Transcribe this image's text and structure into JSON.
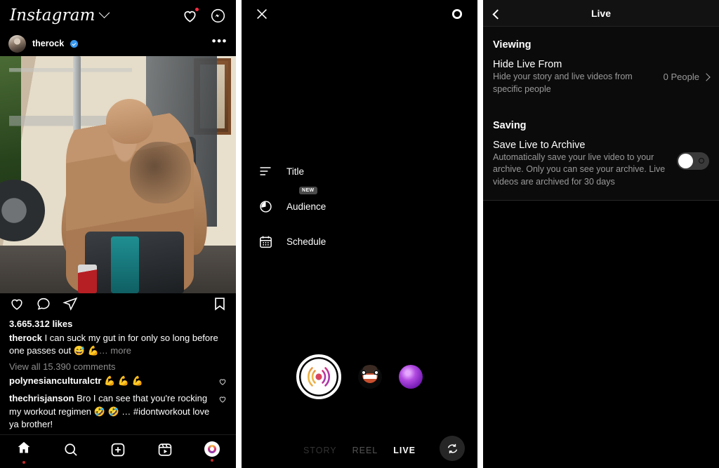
{
  "feed": {
    "app_title": "Instagram",
    "header_icons": [
      "heart-icon",
      "messenger-icon"
    ],
    "post": {
      "username": "therock",
      "verified": true,
      "more_options": "•••",
      "likes": "3.665.312 likes",
      "caption_user": "therock",
      "caption_text": " I can suck my gut in for only so long before one passes out 😅 💪",
      "caption_more": "… more",
      "view_comments": "View all 15.390 comments",
      "comments": [
        {
          "user": "polynesianculturalctr",
          "text": " 💪 💪 💪"
        },
        {
          "user": "thechrisjanson",
          "text": " Bro I can see that you're rocking my workout regimen 🤣 🤣 … #idontworkout love ya brother!"
        }
      ]
    },
    "tabs": [
      {
        "name": "home",
        "icon": "home-icon",
        "badge": true
      },
      {
        "name": "search",
        "icon": "search-icon",
        "badge": false
      },
      {
        "name": "create",
        "icon": "plus-box-icon",
        "badge": false
      },
      {
        "name": "reels",
        "icon": "reels-icon",
        "badge": false
      },
      {
        "name": "profile",
        "icon": "profile-avatar-icon",
        "badge": true
      }
    ]
  },
  "live_composer": {
    "close_label": "✕",
    "settings_icon": "gear-icon",
    "options": [
      {
        "icon": "title-lines-icon",
        "label": "Title",
        "badge": null
      },
      {
        "icon": "audience-icon",
        "label": "Audience",
        "badge": "NEW"
      },
      {
        "icon": "calendar-icon",
        "label": "Schedule",
        "badge": null
      }
    ],
    "shutter": "live-broadcast-button",
    "filters": [
      {
        "name": "face-filter"
      },
      {
        "name": "orb-filter"
      }
    ],
    "modes": [
      {
        "label": "STORY",
        "state": "faded"
      },
      {
        "label": "REEL",
        "state": "off"
      },
      {
        "label": "LIVE",
        "state": "on"
      }
    ],
    "flip_camera": "flip-camera-icon"
  },
  "settings": {
    "back_icon": "chevron-left-icon",
    "title": "Live",
    "sections": [
      {
        "heading": "Viewing",
        "rows": [
          {
            "title": "Hide Live From",
            "description": "Hide your story and live videos from specific people",
            "value": "0 People",
            "control": "chevron"
          }
        ]
      },
      {
        "heading": "Saving",
        "rows": [
          {
            "title": "Save Live to Archive",
            "description": "Automatically save your live video to your archive. Only you can see your archive. Live videos are archived for 30 days",
            "value": "",
            "control": "toggle",
            "toggle_on": false
          }
        ]
      }
    ]
  },
  "colors": {
    "background": "#000000",
    "accent_blue": "#3897f0",
    "notification_red": "#ff2d43",
    "muted_text": "#8e8e8e",
    "divider": "#ffffff"
  }
}
